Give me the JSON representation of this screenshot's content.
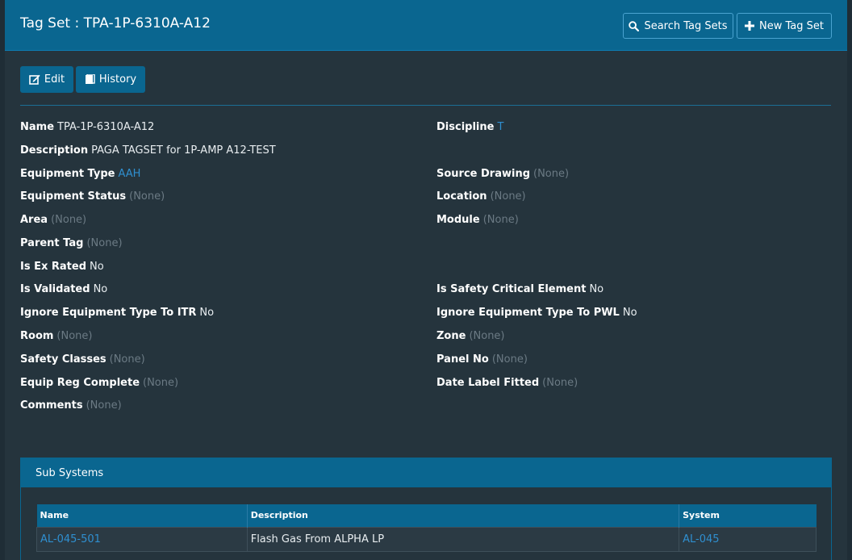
{
  "header": {
    "title": "Tag Set : TPA-1P-6310A-A12",
    "search_label": "Search Tag Sets",
    "new_label": "New Tag Set"
  },
  "actions": {
    "edit_label": "Edit",
    "history_label": "History"
  },
  "fields": {
    "name": {
      "label": "Name",
      "value": "TPA-1P-6310A-A12"
    },
    "discipline": {
      "label": "Discipline",
      "value": "T"
    },
    "description": {
      "label": "Description",
      "value": "PAGA TAGSET for 1P-AMP A12-TEST"
    },
    "equipment_type": {
      "label": "Equipment Type",
      "value": "AAH"
    },
    "source_drawing": {
      "label": "Source Drawing",
      "value": "(None)"
    },
    "equipment_status": {
      "label": "Equipment Status",
      "value": "(None)"
    },
    "location": {
      "label": "Location",
      "value": "(None)"
    },
    "area": {
      "label": "Area",
      "value": "(None)"
    },
    "module": {
      "label": "Module",
      "value": "(None)"
    },
    "parent_tag": {
      "label": "Parent Tag",
      "value": "(None)"
    },
    "is_ex_rated": {
      "label": "Is Ex Rated",
      "value": "No"
    },
    "is_validated": {
      "label": "Is Validated",
      "value": "No"
    },
    "is_safety_critical": {
      "label": "Is Safety Critical Element",
      "value": "No"
    },
    "ignore_itr": {
      "label": "Ignore Equipment Type To ITR",
      "value": "No"
    },
    "ignore_pwl": {
      "label": "Ignore Equipment Type To PWL",
      "value": "No"
    },
    "room": {
      "label": "Room",
      "value": "(None)"
    },
    "zone": {
      "label": "Zone",
      "value": "(None)"
    },
    "safety_classes": {
      "label": "Safety Classes",
      "value": "(None)"
    },
    "panel_no": {
      "label": "Panel No",
      "value": "(None)"
    },
    "equip_reg_complete": {
      "label": "Equip Reg Complete",
      "value": "(None)"
    },
    "date_label_fitted": {
      "label": "Date Label Fitted",
      "value": "(None)"
    },
    "comments": {
      "label": "Comments",
      "value": "(None)"
    }
  },
  "subsystems": {
    "title": "Sub Systems",
    "columns": [
      "Name",
      "Description",
      "System"
    ],
    "rows": [
      {
        "name": "AL-045-501",
        "description": "Flash Gas From ALPHA LP",
        "system": "AL-045"
      }
    ]
  },
  "colors": {
    "accent": "#0a6690",
    "link": "#2f8fd0",
    "muted": "#6b7a84",
    "background": "#25343d"
  }
}
